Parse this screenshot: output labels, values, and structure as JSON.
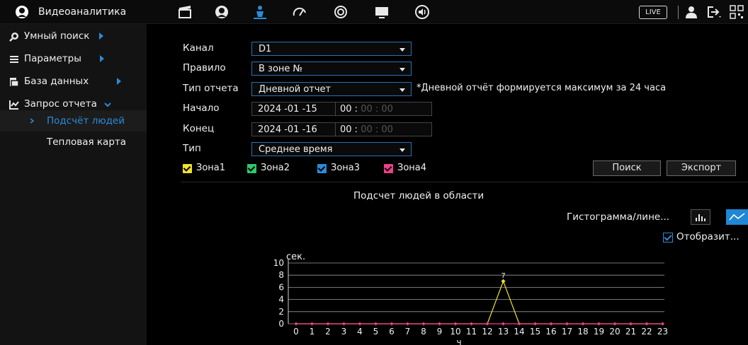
{
  "app": {
    "title": "Видеоаналитика",
    "live_label": "LIVE"
  },
  "toolbar_icons": [
    "clapper-icon",
    "face-icon",
    "person-icon",
    "gauge-icon",
    "circle-icon",
    "monitor-icon",
    "speaker-icon"
  ],
  "sidebar": {
    "items": [
      {
        "label": "Умный поиск",
        "icon": "search-icon"
      },
      {
        "label": "Параметры",
        "icon": "list-icon"
      },
      {
        "label": "База данных",
        "icon": "database-icon"
      },
      {
        "label": "Запрос отчета",
        "icon": "chart-icon"
      }
    ],
    "sub_items": [
      {
        "label": "Подсчёт людей"
      },
      {
        "label": "Тепловая карта"
      }
    ]
  },
  "form": {
    "channel_label": "Канал",
    "channel_value": "D1",
    "rule_label": "Правило",
    "rule_value": "В зоне №",
    "report_type_label": "Тип отчета",
    "report_type_value": "Дневной отчет",
    "report_note": "*Дневной отчёт формируется максимум за 24 часа",
    "start_label": "Начало",
    "start_date": "2024 -01 -15",
    "start_time_hh": "00 :",
    "start_time_rest": "00 : 00",
    "end_label": "Конец",
    "end_date": "2024 -01 -16",
    "end_time_hh": "00 :",
    "end_time_rest": "00 : 00",
    "type_label": "Тип",
    "type_value": "Среднее время"
  },
  "zones": [
    {
      "label": "Зона1",
      "color": "#f2e32a"
    },
    {
      "label": "Зона2",
      "color": "#2ec96a"
    },
    {
      "label": "Зона3",
      "color": "#2a8bd8"
    },
    {
      "label": "Зона4",
      "color": "#ee3f8a"
    }
  ],
  "buttons": {
    "search": "Поиск",
    "export": "Экспорт"
  },
  "chart_panel": {
    "title": "Подсчет людей в области",
    "mode_label": "Гистограмма/лине...",
    "show_label": "Отобразит..."
  },
  "chart_data": {
    "type": "line",
    "ylabel": "сек.",
    "xlabel": "ч",
    "ylim": [
      0,
      10
    ],
    "yticks": [
      0,
      2,
      4,
      6,
      8,
      10
    ],
    "x": [
      0,
      1,
      2,
      3,
      4,
      5,
      6,
      7,
      8,
      9,
      10,
      11,
      12,
      13,
      14,
      15,
      16,
      17,
      18,
      19,
      20,
      21,
      22,
      23
    ],
    "series": [
      {
        "color": "#f2e32a",
        "values": [
          0,
          0,
          0,
          0,
          0,
          0,
          0,
          0,
          0,
          0,
          0,
          0,
          0,
          7,
          0,
          0,
          0,
          0,
          0,
          0,
          0,
          0,
          0,
          0
        ]
      },
      {
        "color": "#ee3f8a",
        "values": [
          0,
          0,
          0,
          0,
          0,
          0,
          0,
          0,
          0,
          0,
          0,
          0,
          0,
          0,
          0,
          0,
          0,
          0,
          0,
          0,
          0,
          0,
          0,
          0
        ]
      }
    ],
    "data_labels": [
      {
        "x": 13,
        "text": "7"
      }
    ]
  }
}
